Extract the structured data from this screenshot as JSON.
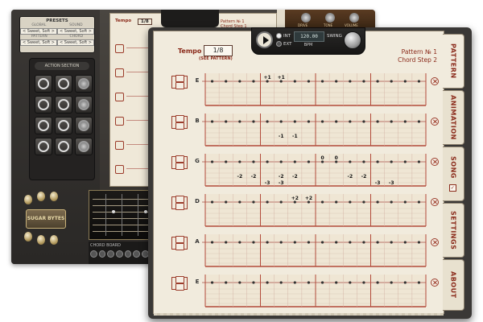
{
  "background_app": {
    "presets": {
      "title": "PRESETS",
      "global_label": "GLOBAL",
      "sound_label": "SOUND",
      "global_value": "< Sweet, Soft >",
      "sound_value": "< Sweet, Soft >",
      "pattern_label": "PATTERN",
      "chord_label": "CHORD",
      "pattern_value": "< Sweet, Soft >",
      "chord_value": "< Sweet, Soft >"
    },
    "action_section": {
      "title": "ACTION SECTION"
    },
    "logo_text": "SUGAR BYTES",
    "chordboard_label": "CHORD BOARD",
    "sheet_tempo": "Tempo",
    "sheet_tempo_value": "1/8",
    "pattern_preview": "Pattern № 1",
    "chord_preview": "Chord Step 1",
    "amp_labels": [
      "DRIVE",
      "TONE",
      "VOLUME"
    ]
  },
  "transport": {
    "int_label": "INT",
    "ext_label": "EXT",
    "bpm_value": "120.00",
    "bpm_label": "BPM",
    "swing_label": "SWING"
  },
  "header": {
    "tempo_label": "Tempo",
    "tempo_value": "1/8",
    "see_pattern": "(SEE PATTERN)",
    "pattern_no": "Pattern №  1",
    "chord_step": "Chord Step  2"
  },
  "strings": [
    {
      "name": "E",
      "row1": [
        null,
        null,
        null,
        null,
        "+1",
        "+1",
        null,
        null,
        null,
        null,
        null,
        null,
        null,
        null,
        null,
        null
      ],
      "row2": []
    },
    {
      "name": "B",
      "row1": [
        null,
        null,
        null,
        null,
        null,
        null,
        null,
        null,
        null,
        null,
        null,
        null,
        null,
        null,
        null,
        null
      ],
      "row2": [
        "",
        "",
        "",
        "",
        "",
        "-1",
        "-1",
        "",
        "",
        "",
        "",
        "",
        "",
        "",
        "",
        ""
      ]
    },
    {
      "name": "G",
      "row1": [
        null,
        null,
        null,
        null,
        null,
        null,
        null,
        null,
        "0",
        "0",
        null,
        null,
        null,
        null,
        null,
        null
      ],
      "row2": [
        "",
        "",
        "-2",
        "-2",
        "",
        "-2",
        "-2",
        "",
        "",
        "",
        "-2",
        "-2",
        "",
        "",
        "",
        ""
      ],
      "row3": [
        "",
        "",
        "",
        "",
        "-3",
        "-3",
        "",
        "",
        "",
        "",
        "",
        "",
        "-3",
        "-3",
        "",
        ""
      ]
    },
    {
      "name": "D",
      "row1": [
        null,
        null,
        null,
        null,
        null,
        null,
        "+2",
        "+2",
        null,
        null,
        null,
        null,
        null,
        null,
        null,
        null
      ],
      "row2": []
    },
    {
      "name": "A",
      "row1": [
        null,
        null,
        null,
        null,
        null,
        null,
        null,
        null,
        null,
        null,
        null,
        null,
        null,
        null,
        null,
        null
      ],
      "row2": []
    },
    {
      "name": "E",
      "row1": [
        null,
        null,
        null,
        null,
        null,
        null,
        null,
        null,
        null,
        null,
        null,
        null,
        null,
        null,
        null,
        null
      ],
      "row2": []
    }
  ],
  "tabs": [
    {
      "label": "PATTERN"
    },
    {
      "label": "ANIMATION"
    },
    {
      "label": "SONG",
      "checked": "✓"
    },
    {
      "label": "SETTINGS"
    },
    {
      "label": "ABOUT"
    }
  ],
  "colors": {
    "accent_red": "#8a2a1a",
    "paper": "#f1ebdd",
    "grid_line": "#c48b7f"
  }
}
